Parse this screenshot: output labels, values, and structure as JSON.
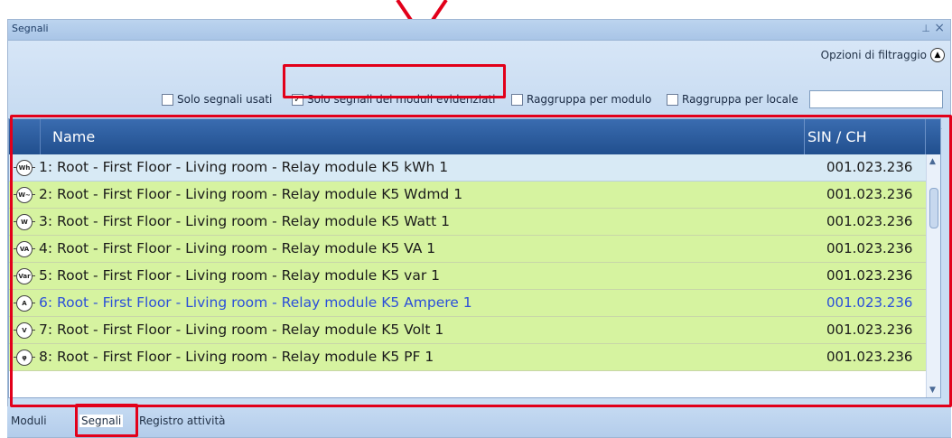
{
  "panel": {
    "title": "Segnali",
    "filter_options_label": "Opzioni di filtraggio",
    "checkboxes": [
      {
        "label": "Solo segnali usati",
        "checked": false
      },
      {
        "label": "Solo segnali dei moduli evidenziati",
        "checked": true
      },
      {
        "label": "Raggruppa per modulo",
        "checked": false
      },
      {
        "label": "Raggruppa per locale",
        "checked": false
      }
    ],
    "filter_text_value": ""
  },
  "grid": {
    "columns": [
      "Name",
      "SIN / CH"
    ],
    "rows": [
      {
        "icon": "kwh-meter-icon",
        "icon_text": "Wh",
        "name": "1: Root - First Floor - Living room - Relay module K5 kWh 1",
        "sin": "001.023.236",
        "selected": true
      },
      {
        "icon": "wdmd-meter-icon",
        "icon_text": "W~",
        "name": "2: Root - First Floor - Living room - Relay module K5 Wdmd 1",
        "sin": "001.023.236"
      },
      {
        "icon": "watt-meter-icon",
        "icon_text": "W",
        "name": "3: Root - First Floor - Living room - Relay module K5 Watt 1",
        "sin": "001.023.236"
      },
      {
        "icon": "va-meter-icon",
        "icon_text": "VA",
        "name": "4: Root - First Floor - Living room - Relay module K5 VA 1",
        "sin": "001.023.236"
      },
      {
        "icon": "var-meter-icon",
        "icon_text": "Var",
        "name": "5: Root - First Floor - Living room - Relay module K5 var 1",
        "sin": "001.023.236"
      },
      {
        "icon": "ampere-meter-icon",
        "icon_text": "A",
        "name": "6: Root - First Floor - Living room - Relay module K5 Ampere 1",
        "sin": "001.023.236",
        "highlight": "blue"
      },
      {
        "icon": "volt-meter-icon",
        "icon_text": "V",
        "name": "7: Root - First Floor - Living room - Relay module K5 Volt 1",
        "sin": "001.023.236"
      },
      {
        "icon": "pf-meter-icon",
        "icon_text": "φ",
        "name": "8: Root - First Floor - Living room - Relay module K5 PF 1",
        "sin": "001.023.236"
      }
    ]
  },
  "tabs": [
    {
      "label": "Moduli",
      "active": false
    },
    {
      "label": "Segnali",
      "active": true
    },
    {
      "label": "Registro attività",
      "active": false
    }
  ],
  "colors": {
    "row_green": "#d6f3a0",
    "row_selected": "#d8eaf5",
    "header_blue": "#2a5a9c",
    "annotation_red": "#e2001a",
    "link_blue": "#2b4fd9"
  }
}
